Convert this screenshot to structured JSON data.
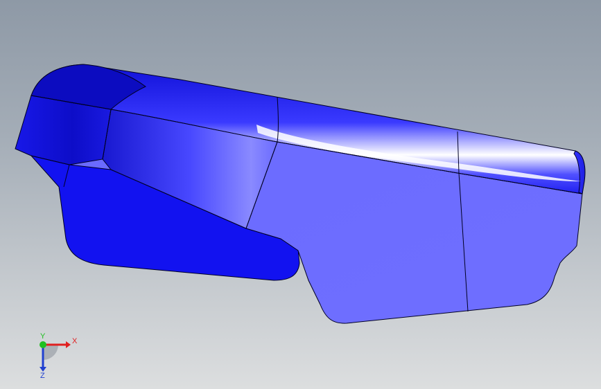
{
  "viewport": {
    "background_top": "#8e99a6",
    "background_bottom": "#dcdedf",
    "model_color": "#2a2aff",
    "edge_color": "#000033"
  },
  "triad": {
    "x_label": "X",
    "y_label": "Y",
    "z_label": "Z",
    "x_color": "#e02020",
    "y_color": "#20c020",
    "z_color": "#2040d0"
  }
}
